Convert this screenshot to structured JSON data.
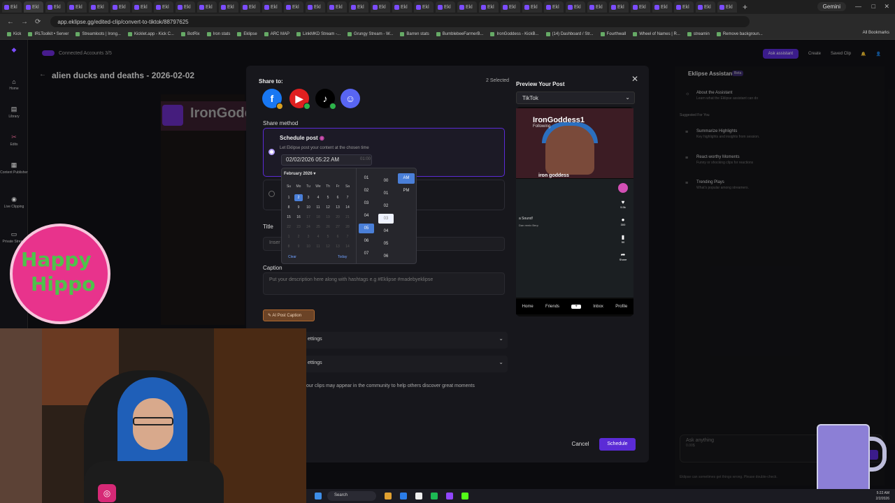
{
  "browser": {
    "tab_label": "Ekl",
    "tab_count": 34,
    "gemini": "Gemini",
    "url": "app.eklipse.gg/edited-clip/convert-to-tiktok/88797625",
    "all_bookmarks": "All Bookmarks",
    "bookmarks": [
      "Kick",
      "IRLToolkit • Server",
      "Streamloots | Irong...",
      "Kicklet.app - Kick C...",
      "BotRix",
      "Iron stats",
      "Eklipse",
      "ARC MAP",
      "LinkMKD Stream -...",
      "Grungy Stream - W...",
      "Barren stats",
      "BumblebeeFarmerB...",
      "IronGoddess - KickB...",
      "(14) Dashboard / Str...",
      "Fourthwall",
      "Wheel of Names | R...",
      "streamin",
      "Remove backgroun..."
    ]
  },
  "sidebar": {
    "items": [
      {
        "label": "Home",
        "icon": "home-icon"
      },
      {
        "label": "Library",
        "icon": "library-icon"
      },
      {
        "label": "Edits",
        "icon": "scissors-icon"
      },
      {
        "label": "Content Publisher",
        "icon": "calendar-icon"
      },
      {
        "label": "Live Clipping",
        "icon": "live-icon"
      },
      {
        "label": "Private Stream",
        "icon": "monitor-icon"
      }
    ]
  },
  "header": {
    "connected_accounts": "Connected Accounts 3/5",
    "ask_assistant": "Ask assistant",
    "create": "Create",
    "saved_clip": "Saved Clip",
    "page_title": "alien ducks and deaths - 2026-02-02"
  },
  "assistant": {
    "title": "Eklipse Assistant",
    "beta": "Beta",
    "about_title": "About the Assistant",
    "about_sub": "Learn what the Eklipse assistant can do",
    "suggested": "Suggested For You",
    "cards": [
      {
        "title": "Summarize Highlights",
        "sub": "Key highlights and insights from session."
      },
      {
        "title": "React-worthy Moments",
        "sub": "Funny or shocking clips for reactions"
      },
      {
        "title": "Trending Plays",
        "sub": "What's popular among streamers."
      }
    ],
    "input_placeholder": "Ask anything",
    "credits": "0.00$",
    "disclaimer": "Eklipse can sometimes get things wrong. Please double-check."
  },
  "modal": {
    "share_to": "Share to:",
    "selected": "2 Selected",
    "share_method": "Share method",
    "schedule_title": "Schedule post",
    "schedule_desc": "Let Eklipse post your content at the chosen time",
    "date_value": "02/02/2026 05:22 AM",
    "time_hint": "01:00",
    "title_label": "Title",
    "title_placeholder": "Inser",
    "caption_label": "Caption",
    "caption_placeholder": "Put your description here along with hashtags e.g #Eklipse #madebyeklipse",
    "ai_caption": "AI Post Caption",
    "settings_1": "ettings",
    "settings_2": "ettings",
    "community_text": "our clips may appear in the community to help others discover great moments",
    "cancel": "Cancel",
    "schedule": "Schedule"
  },
  "preview": {
    "title": "Preview Your Post",
    "platform": "TikTok",
    "handle": "IronGoddess1",
    "following": "Following",
    "name_overlay": "iron goddess",
    "sound": "a Sound!",
    "sound_sub": "Dan remix Berp",
    "actions": [
      "5.5k",
      "300",
      "50",
      "Share"
    ],
    "nav": [
      "Home",
      "Friends",
      "+",
      "Inbox",
      "Profile"
    ]
  },
  "datepicker": {
    "month": "February 2026",
    "dow": [
      "Su",
      "Mo",
      "Tu",
      "We",
      "Th",
      "Fr",
      "Sa"
    ],
    "weeks": [
      [
        "1",
        "2",
        "3",
        "4",
        "5",
        "6",
        "7"
      ],
      [
        "8",
        "9",
        "10",
        "11",
        "12",
        "13",
        "14"
      ],
      [
        "15",
        "16",
        "17",
        "18",
        "19",
        "20",
        "21"
      ],
      [
        "22",
        "23",
        "24",
        "25",
        "26",
        "27",
        "28"
      ],
      [
        "1",
        "2",
        "3",
        "4",
        "5",
        "6",
        "7"
      ],
      [
        "8",
        "9",
        "10",
        "11",
        "12",
        "13",
        "14"
      ]
    ],
    "clear": "Clear",
    "today": "Today",
    "hours": [
      "01",
      "02",
      "03",
      "04",
      "05",
      "06",
      "07"
    ],
    "minutes": [
      "00",
      "01",
      "02",
      "03",
      "04",
      "05",
      "06"
    ],
    "am": "AM",
    "pm": "PM"
  },
  "overlay": {
    "hippo_line1": "Happy",
    "hippo_line2": "Hippo",
    "twitch_name": "IronGoddess"
  },
  "taskbar": {
    "search": "Search",
    "time": "5:22 AM",
    "date": "2/2/2026"
  }
}
